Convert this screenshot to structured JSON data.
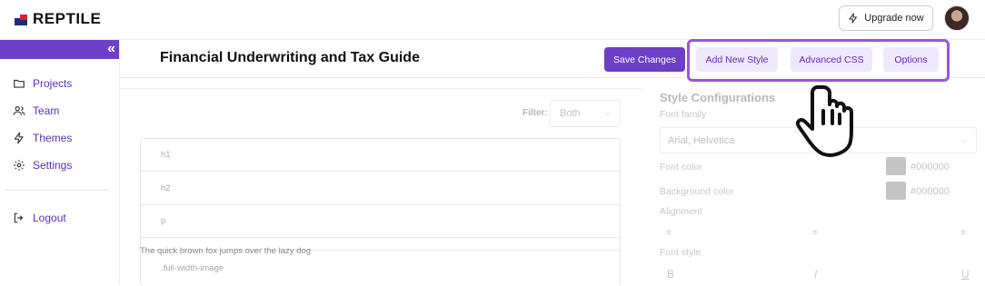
{
  "brand": {
    "name": "REPTILE"
  },
  "topbar": {
    "upgrade_label": "Upgrade now"
  },
  "sidebar": {
    "collapse_glyph": "«",
    "items": [
      {
        "label": "Projects",
        "icon": "folder-icon"
      },
      {
        "label": "Team",
        "icon": "users-icon"
      },
      {
        "label": "Themes",
        "icon": "bolt-icon"
      },
      {
        "label": "Settings",
        "icon": "gear-icon"
      }
    ],
    "logout_label": "Logout"
  },
  "header": {
    "title": "Financial Underwriting and Tax Guide",
    "save_label": "Save Changes",
    "add_style_label": "Add New Style",
    "advanced_css_label": "Advanced CSS",
    "options_label": "Options"
  },
  "editor": {
    "filter_label": "Filter:",
    "filter_value": "Both",
    "rows": [
      "h1",
      "h2",
      "p",
      ".full-width-image"
    ],
    "sample_text": "The quick brown fox jumps over the lazy dog"
  },
  "config": {
    "title": "Style Configurations",
    "font_family_label": "Font family",
    "font_family_value": "Arial, Helvetica",
    "font_color_label": "Font color",
    "font_color_value": "#000000",
    "bg_color_label": "Background color",
    "bg_color_value": "#000000",
    "alignment_label": "Alignment",
    "font_style_label": "Font style",
    "font_style_glyphs": [
      "B",
      "I",
      "U"
    ]
  },
  "colors": {
    "accent": "#6d3fc8",
    "soft": "#efe7fb",
    "highlight": "#9a55d8"
  }
}
